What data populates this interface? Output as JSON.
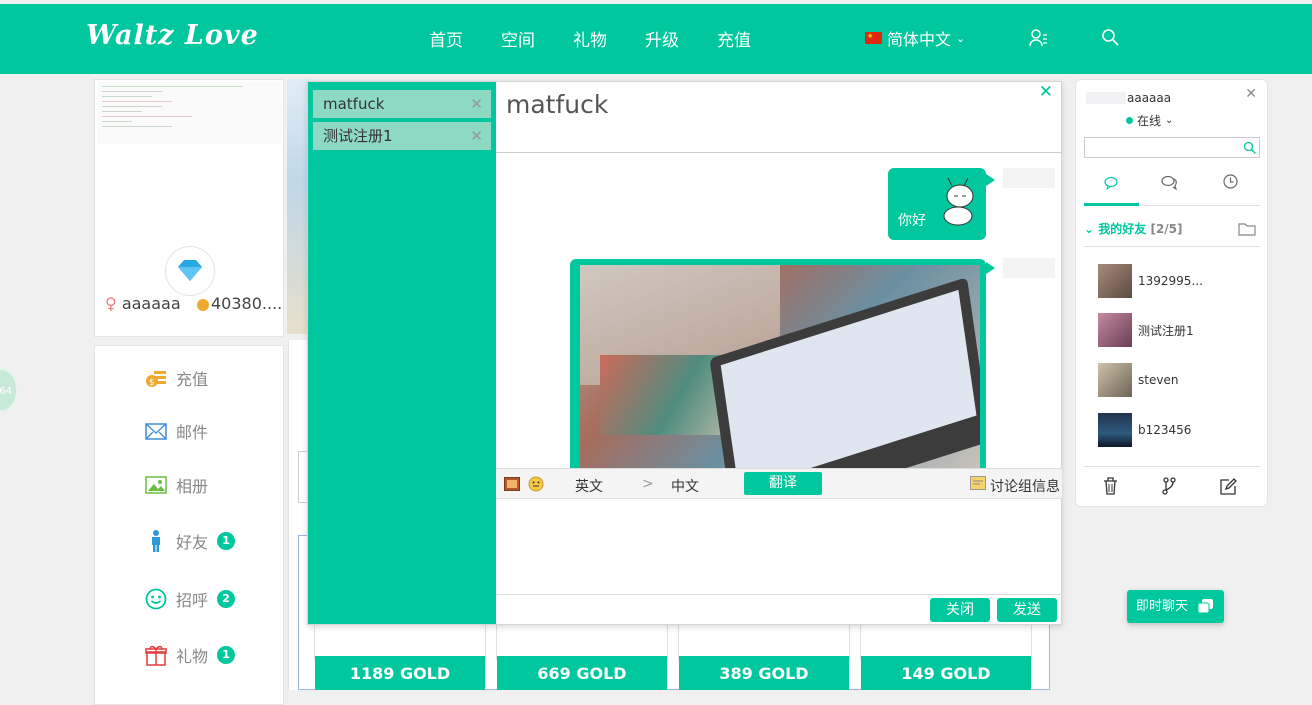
{
  "header": {
    "logo": "Waltz Love",
    "nav": [
      "首页",
      "空间",
      "礼物",
      "升级",
      "充值"
    ],
    "language": "简体中文"
  },
  "profile": {
    "name": "aaaaaa",
    "coins": "40380...."
  },
  "menu": [
    {
      "label": "充值",
      "icon": "coins-icon",
      "badge": ""
    },
    {
      "label": "邮件",
      "icon": "mail-icon",
      "badge": ""
    },
    {
      "label": "相册",
      "icon": "photo-icon",
      "badge": ""
    },
    {
      "label": "好友",
      "icon": "person-icon",
      "badge": "1"
    },
    {
      "label": "招呼",
      "icon": "smile-icon",
      "badge": "2"
    },
    {
      "label": "礼物",
      "icon": "gift-icon",
      "badge": "1"
    }
  ],
  "side_circle": "64",
  "gold_packages": [
    "1189 GOLD",
    "669 GOLD",
    "389 GOLD",
    "149 GOLD"
  ],
  "chat": {
    "tabs": [
      "matfuck",
      "测试注册1"
    ],
    "title": "matfuck",
    "message_text": "你好",
    "lang_from": "英文",
    "lang_arrow": ">",
    "lang_to": "中文",
    "translate_label": "翻译",
    "group_info_label": "讨论组信息",
    "close_label": "关闭",
    "send_label": "发送"
  },
  "friends_panel": {
    "username": "aaaaaa",
    "status": "在线",
    "group_label": "我的好友",
    "group_count": "[2/5]",
    "friends": [
      "1392995...",
      "测试注册1",
      "steven",
      "b123456"
    ]
  },
  "instant_chat_label": "即时聊天",
  "colors": {
    "accent": "#00c79d",
    "gold": "#f0a930"
  }
}
